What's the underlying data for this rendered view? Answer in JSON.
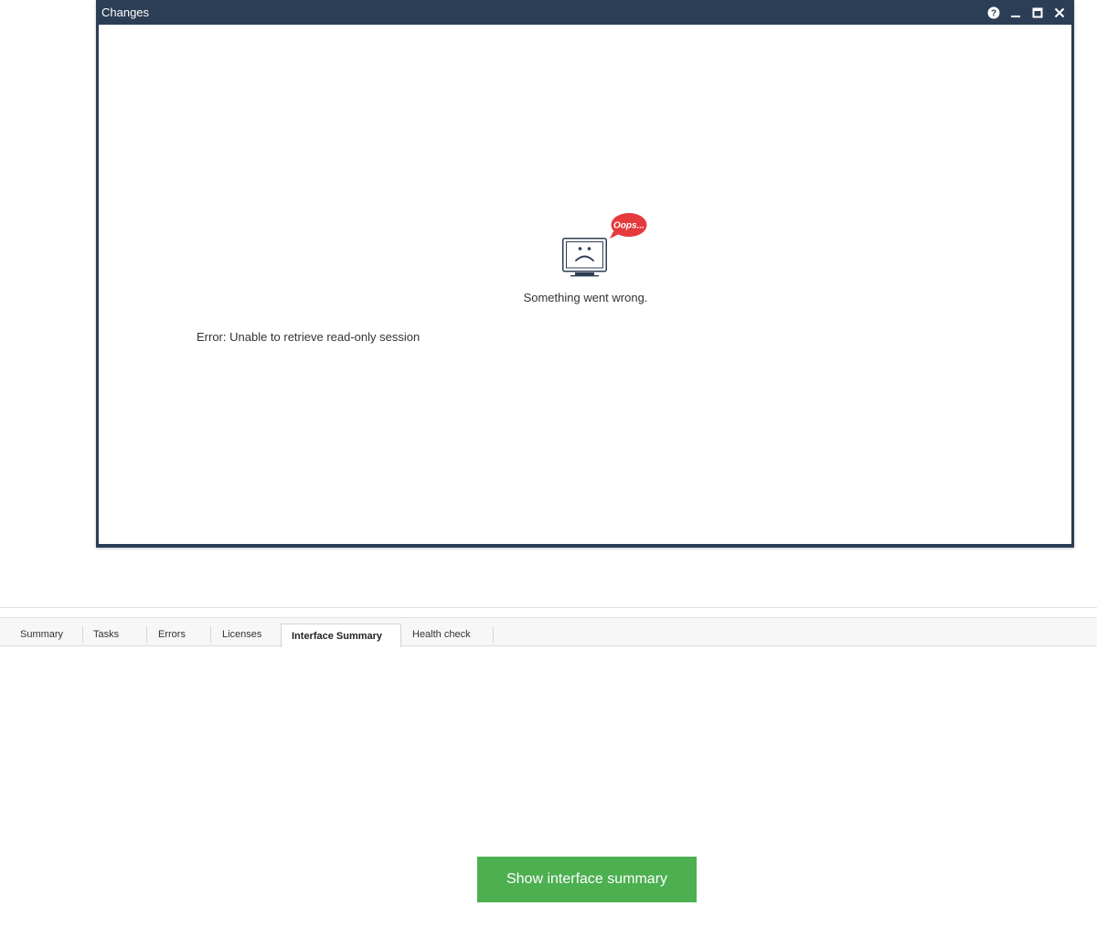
{
  "window": {
    "title": "Changes",
    "controls": {
      "help_icon": "help-icon",
      "minimize_icon": "minimize-icon",
      "maximize_icon": "maximize-icon",
      "close_icon": "close-icon"
    }
  },
  "error_panel": {
    "bubble_text": "Oops...",
    "message": "Something went wrong.",
    "detail": "Error: Unable to retrieve read-only session",
    "illustration_icon": "sad-monitor-icon",
    "bubble_color": "#e5393d"
  },
  "tabs": [
    {
      "label": "Summary",
      "active": false
    },
    {
      "label": "Tasks",
      "active": false
    },
    {
      "label": "Errors",
      "active": false
    },
    {
      "label": "Licenses",
      "active": false
    },
    {
      "label": "Interface Summary",
      "active": true
    },
    {
      "label": "Health check",
      "active": false
    }
  ],
  "actions": {
    "show_summary_label": "Show interface summary",
    "button_color": "#4caf50"
  },
  "colors": {
    "titlebar": "#2c3e55",
    "text": "#333333"
  }
}
